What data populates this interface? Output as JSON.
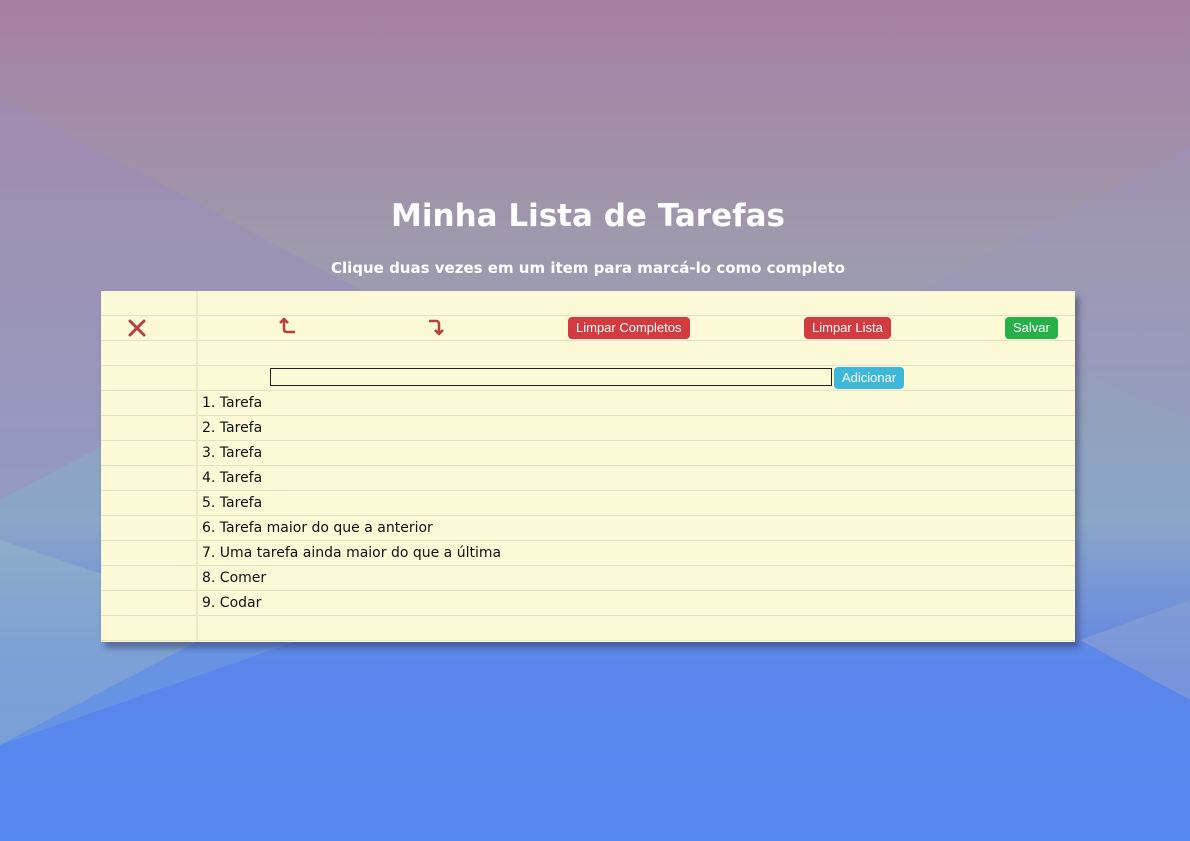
{
  "header": {
    "title": "Minha Lista de Tarefas",
    "subtitle": "Clique duas vezes em um item para marcá-lo como completo"
  },
  "toolbar": {
    "delete_icon": "close-icon",
    "undo_icon": "undo-arrow-icon",
    "redo_icon": "redo-arrow-icon",
    "clear_completed_label": "Limpar Completos",
    "clear_list_label": "Limpar Lista",
    "save_label": "Salvar"
  },
  "input": {
    "value": "",
    "placeholder": "",
    "add_label": "Adicionar"
  },
  "tasks": [
    "1. Tarefa",
    "2. Tarefa",
    "3. Tarefa",
    "4. Tarefa",
    "5. Tarefa",
    "6. Tarefa maior do que a anterior",
    "7. Uma tarefa ainda maior do que a última",
    "8. Comer",
    "9. Codar"
  ],
  "colors": {
    "paper": "#fcf9d7",
    "danger": "#d23b3f",
    "success": "#27b04a",
    "info": "#3db8d9",
    "icon": "#b5423c"
  }
}
